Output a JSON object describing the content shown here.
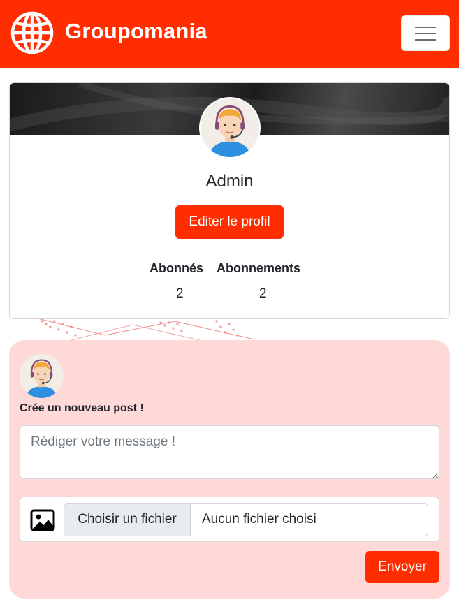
{
  "navbar": {
    "brand": "Groupomania",
    "logo_icon": "globe-icon",
    "menu_icon": "hamburger-icon",
    "color": "#ff2d00"
  },
  "profile": {
    "username": "Admin",
    "edit_label": "Editer le profil",
    "stats": [
      {
        "label": "Abonnés",
        "value": "2"
      },
      {
        "label": "Abonnements",
        "value": "2"
      }
    ]
  },
  "new_post": {
    "heading": "Crée un nouveau post !",
    "message_placeholder": "Rédiger votre message !",
    "message_value": "",
    "image_icon": "image-icon",
    "file_button": "Choisir un fichier",
    "file_status": "Aucun fichier choisi",
    "submit_label": "Envoyer"
  },
  "colors": {
    "accent": "#ff2d00",
    "post_background": "#ffd8d8"
  }
}
